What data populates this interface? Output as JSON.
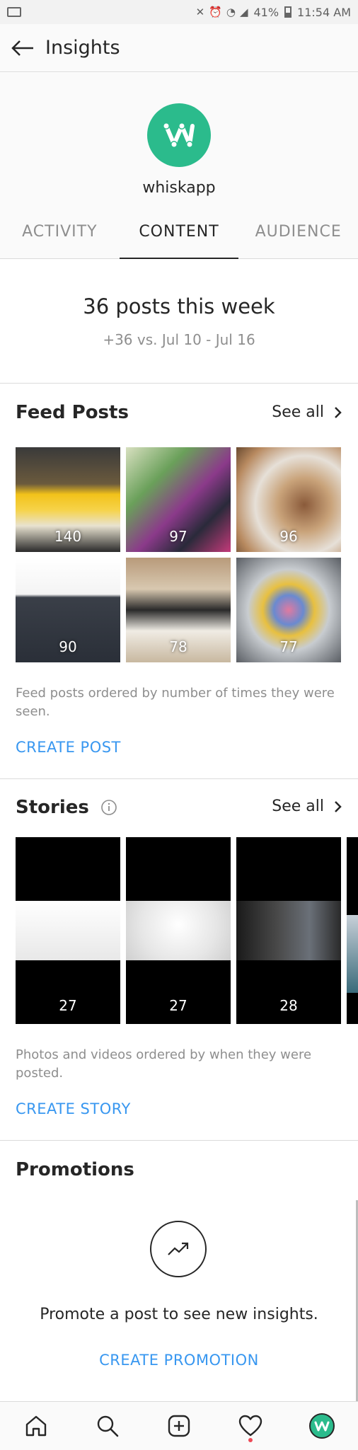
{
  "status_bar": {
    "battery": "41%",
    "time": "11:54 AM"
  },
  "header": {
    "title": "Insights"
  },
  "profile": {
    "name": "whiskapp",
    "brand_color": "#2bbb8c"
  },
  "tabs": [
    {
      "label": "ACTIVITY",
      "active": false
    },
    {
      "label": "CONTENT",
      "active": true
    },
    {
      "label": "AUDIENCE",
      "active": false
    }
  ],
  "summary": {
    "headline": "36 posts this week",
    "comparison": "+36 vs. Jul 10 - Jul 16"
  },
  "feed_posts": {
    "title": "Feed Posts",
    "see_all": "See all",
    "posts": [
      {
        "count": "140"
      },
      {
        "count": "97"
      },
      {
        "count": "96"
      },
      {
        "count": "90"
      },
      {
        "count": "78"
      },
      {
        "count": "77"
      }
    ],
    "note": "Feed posts ordered by number of times they were seen.",
    "cta": "CREATE POST"
  },
  "stories": {
    "title": "Stories",
    "see_all": "See all",
    "items": [
      {
        "count": "27"
      },
      {
        "count": "27"
      },
      {
        "count": "28"
      }
    ],
    "note": "Photos and videos ordered by when they were posted.",
    "cta": "CREATE STORY"
  },
  "promotions": {
    "title": "Promotions",
    "message": "Promote a post to see new insights.",
    "cta": "CREATE PROMOTION"
  },
  "colors": {
    "link": "#3897f0",
    "notification": "#ed4956"
  }
}
